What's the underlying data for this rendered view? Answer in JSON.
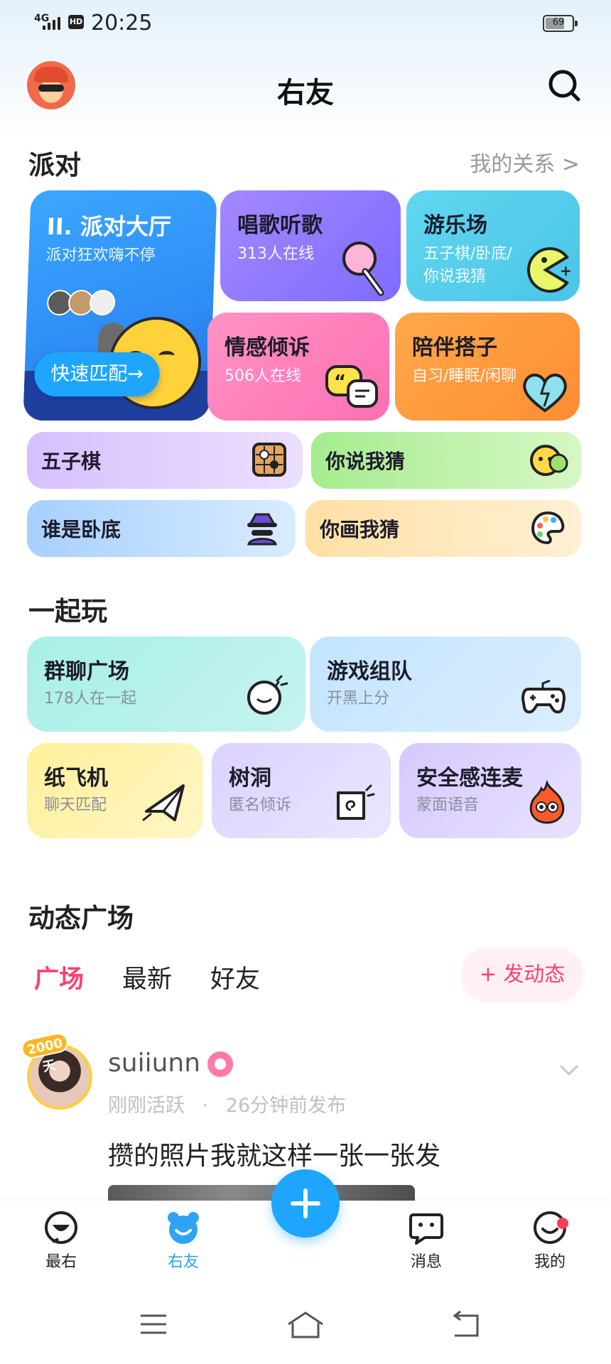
{
  "status_bar": {
    "network": "4G",
    "hd": "HD",
    "time": "20:25",
    "battery": "69"
  },
  "header": {
    "title": "右友"
  },
  "party": {
    "title": "派对",
    "link": "我的关系 >",
    "lobby": {
      "title": "II. 派对大厅",
      "subtitle": "派对狂欢嗨不停",
      "button": "快速匹配→"
    },
    "cards": [
      {
        "title": "唱歌听歌",
        "subtitle": "313人在线"
      },
      {
        "title": "游乐场",
        "subtitle": "五子棋/卧底/\n你说我猜"
      },
      {
        "title": "情感倾诉",
        "subtitle": "506人在线"
      },
      {
        "title": "陪伴搭子",
        "subtitle": "自习/睡眠/闲聊"
      }
    ],
    "games": [
      {
        "title": "五子棋"
      },
      {
        "title": "你说我猜"
      },
      {
        "title": "谁是卧底"
      },
      {
        "title": "你画我猜"
      }
    ]
  },
  "play_together": {
    "title": "一起玩",
    "cards": [
      {
        "title": "群聊广场",
        "subtitle": "178人在一起"
      },
      {
        "title": "游戏组队",
        "subtitle": "开黑上分"
      },
      {
        "title": "纸飞机",
        "subtitle": "聊天匹配"
      },
      {
        "title": "树洞",
        "subtitle": "匿名倾诉"
      },
      {
        "title": "安全感连麦",
        "subtitle": "蒙面语音"
      }
    ]
  },
  "feed": {
    "title": "动态广场",
    "tabs": [
      "广场",
      "最新",
      "好友"
    ],
    "active_tab": "广场",
    "post_button": "+ 发动态",
    "post": {
      "badge": "2000天",
      "username": "suiiunn",
      "active": "刚刚活跃",
      "separator": "·",
      "time": "26分钟前发布",
      "text": "攒的照片我就这样一张一张发"
    }
  },
  "bottom_nav": {
    "items": [
      {
        "label": "最右",
        "icon": "face-icon"
      },
      {
        "label": "右友",
        "icon": "bear-icon"
      },
      {
        "label": "消息",
        "icon": "chat-icon"
      },
      {
        "label": "我的",
        "icon": "profile-icon"
      }
    ],
    "active": "右友"
  },
  "colors": {
    "accent": "#1ea6ff",
    "feed_active": "#ff3f6c",
    "link_gray": "#999999"
  }
}
